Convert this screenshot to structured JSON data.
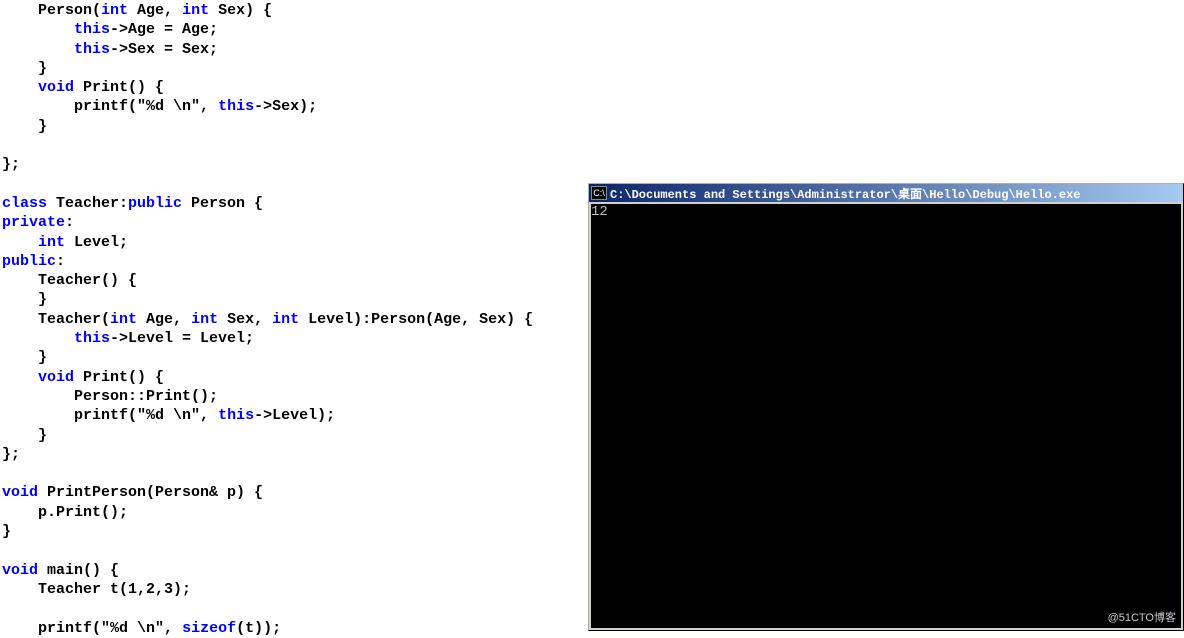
{
  "code": {
    "l01": "    Person(",
    "l01b": " Age, ",
    "l01c": " Sex) {",
    "l02a": "        ",
    "l02b": "->Age = Age;",
    "l03a": "        ",
    "l03b": "->Sex = Sex;",
    "l04": "    }",
    "l05a": "    ",
    "l05b": " Print() {",
    "l06a": "        printf(",
    "l06b": "\"%d \\n\"",
    "l06c": ", ",
    "l06d": "->Sex);",
    "l07": "    }",
    "l08": "",
    "l09": "};",
    "l10": "",
    "l11a": " Teacher:",
    "l11b": " Person {",
    "l12": ":",
    "l13a": "    ",
    "l13b": " Level;",
    "l14": ":",
    "l15": "    Teacher() {",
    "l16": "    }",
    "l17a": "    Teacher(",
    "l17b": " Age, ",
    "l17c": " Sex, ",
    "l17d": " Level):Person(Age, Sex) {",
    "l18a": "        ",
    "l18b": "->Level = Level;",
    "l19": "    }",
    "l20a": "    ",
    "l20b": " Print() {",
    "l21": "        Person::Print();",
    "l22a": "        printf(",
    "l22b": "\"%d \\n\"",
    "l22c": ", ",
    "l22d": "->Level);",
    "l23": "    }",
    "l24": "};",
    "l25": "",
    "l26a": " PrintPerson(Person& p) {",
    "l27": "    p.Print();",
    "l28": "}",
    "l29": "",
    "l30a": " main() {",
    "l31": "    Teacher t(1,2,3);",
    "l32": "",
    "l33a": "    printf(",
    "l33b": "\"%d \\n\"",
    "l33c": ", ",
    "l33d": "(t));",
    "kw_int": "int",
    "kw_this": "this",
    "kw_void": "void",
    "kw_class": "class",
    "kw_public": "public",
    "kw_private": "private",
    "kw_sizeof": "sizeof"
  },
  "console": {
    "icon": "C:\\",
    "title": " C:\\Documents and Settings\\Administrator\\桌面\\Hello\\Debug\\Hello.exe",
    "output_line1": "12"
  },
  "watermark": "@51CTO博客"
}
